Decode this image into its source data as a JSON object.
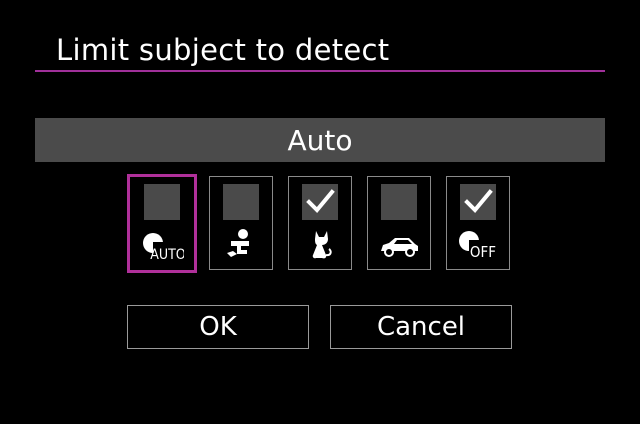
{
  "title": "Limit subject to detect",
  "mode_label": "Auto",
  "subjects": [
    {
      "name": "auto",
      "icon": "subject-auto-icon",
      "icon_text": "AUTO",
      "checked": false,
      "selected": true
    },
    {
      "name": "people",
      "icon": "person-icon",
      "checked": false,
      "selected": false
    },
    {
      "name": "animals",
      "icon": "animal-icon",
      "checked": true,
      "selected": false
    },
    {
      "name": "vehicles",
      "icon": "car-icon",
      "checked": false,
      "selected": false
    },
    {
      "name": "off",
      "icon": "subject-off-icon",
      "icon_text": "OFF",
      "checked": true,
      "selected": false
    }
  ],
  "buttons": {
    "ok": "OK",
    "cancel": "Cancel"
  },
  "colors": {
    "accent": "#b0309a",
    "bar": "#4b4b4b",
    "checkbox": "#4a4a4a",
    "background": "#000000"
  }
}
